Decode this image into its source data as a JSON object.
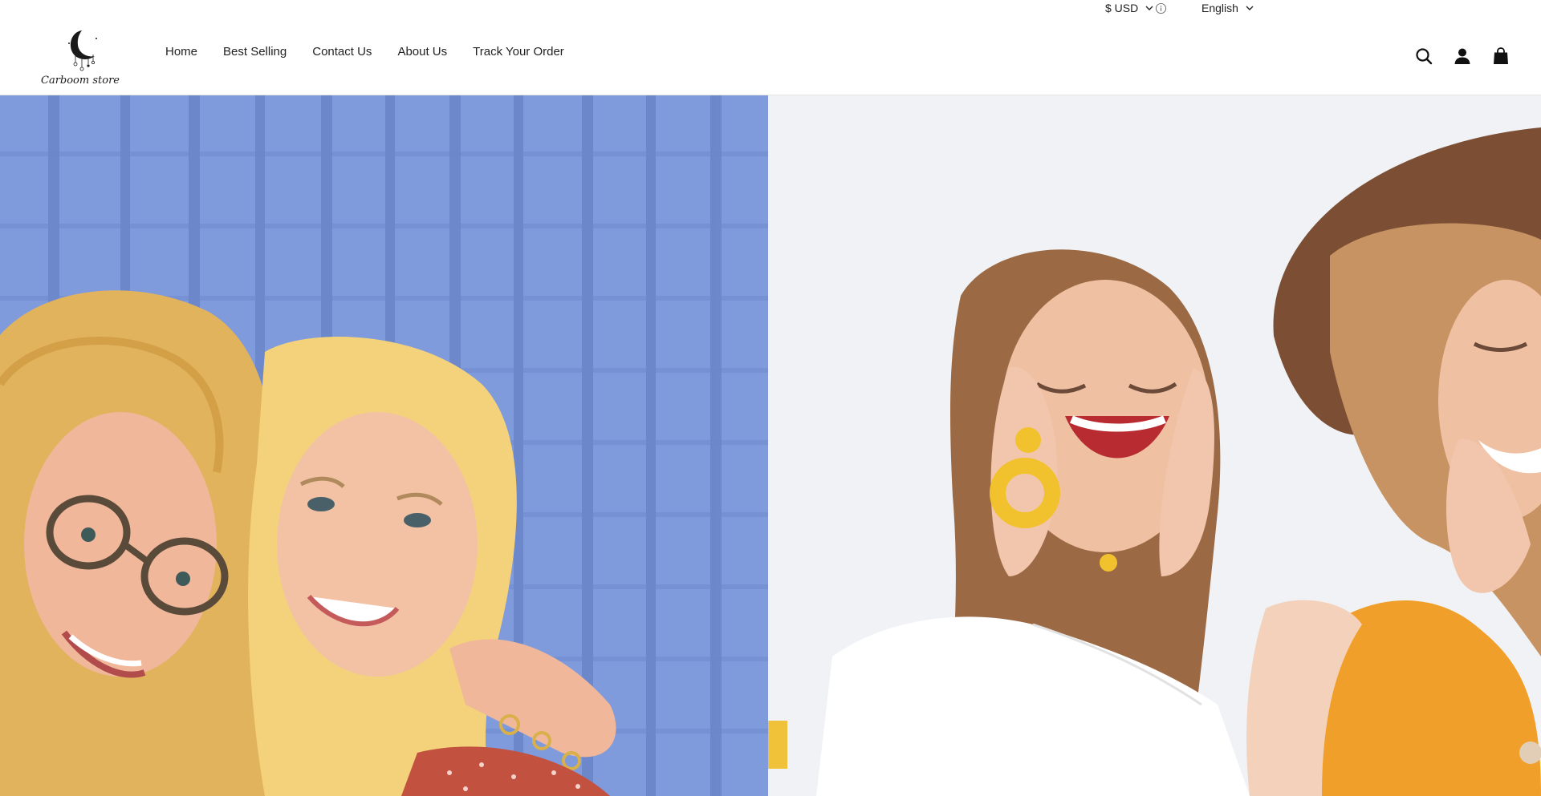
{
  "utility_bar": {
    "currency": "$ USD",
    "language": "English"
  },
  "header": {
    "logo_text": "Carboom store",
    "nav": [
      {
        "label": "Home"
      },
      {
        "label": "Best Selling"
      },
      {
        "label": "Contact Us"
      },
      {
        "label": "About Us"
      },
      {
        "label": "Track Your Order"
      }
    ],
    "icons": [
      "search-icon",
      "account-icon",
      "cart-icon"
    ]
  },
  "hero": {
    "slides": [
      {
        "image": "two-blonde-women-smiling-blue-brick-wall"
      },
      {
        "image": "two-women-laughing-yellow-earrings-hat"
      }
    ]
  },
  "colors": {
    "text": "#222222",
    "border": "#e4e4e4",
    "wall_blue": "#7f9bdc",
    "bg_light": "#eeeff2",
    "earring_yellow": "#f2c12e",
    "top_orange": "#f0a02a",
    "hat_brown": "#7c4f35"
  }
}
